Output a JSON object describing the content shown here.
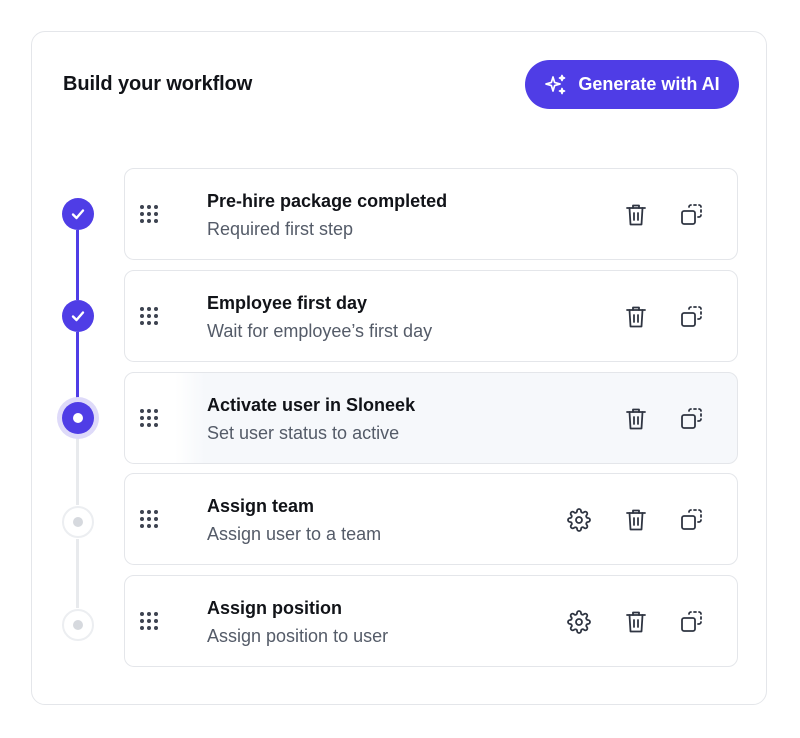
{
  "header": {
    "title": "Build your workflow",
    "ai_button_label": "Generate with AI",
    "ai_button_icon": "sparkles-icon"
  },
  "colors": {
    "accent": "#4f3de6",
    "accent_soft": "#dedaf9",
    "pending": "#d6d9de",
    "text_primary": "#111318",
    "text_secondary": "#545b68"
  },
  "steps": [
    {
      "title": "Pre-hire package completed",
      "subtitle": "Required first step",
      "status": "completed",
      "has_settings": false
    },
    {
      "title": "Employee first day",
      "subtitle": "Wait for employee’s first day",
      "status": "completed",
      "has_settings": false
    },
    {
      "title": "Activate user in Sloneek",
      "subtitle": "Set user status to active",
      "status": "active",
      "has_settings": false
    },
    {
      "title": "Assign team",
      "subtitle": "Assign user to a team",
      "status": "pending",
      "has_settings": true
    },
    {
      "title": "Assign position",
      "subtitle": "Assign position to user",
      "status": "pending",
      "has_settings": true
    }
  ],
  "icons": {
    "drag": "drag-handle-icon",
    "settings": "gear-icon",
    "delete": "trash-icon",
    "duplicate": "duplicate-icon",
    "completed": "check-icon"
  }
}
